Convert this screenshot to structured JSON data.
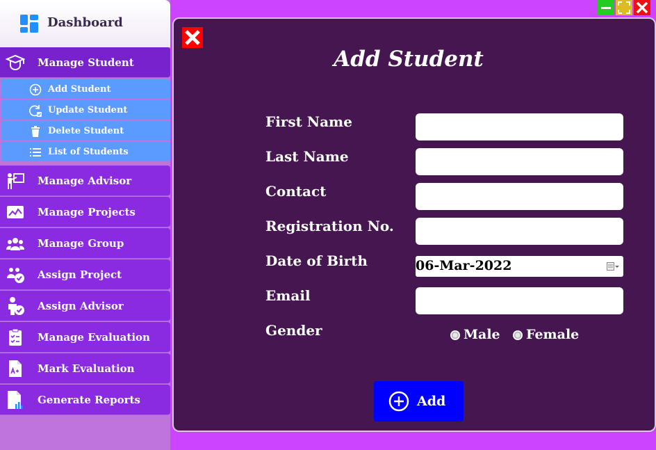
{
  "sidebar": {
    "dashboard_label": "Dashboard",
    "items": [
      {
        "label": "Manage Student",
        "icon": "graduate-icon"
      },
      {
        "label": "Manage Advisor",
        "icon": "teacher-board-icon"
      },
      {
        "label": "Manage Projects",
        "icon": "chart-image-icon"
      },
      {
        "label": "Manage Group",
        "icon": "group-icon"
      },
      {
        "label": "Assign Project",
        "icon": "people-check-icon"
      },
      {
        "label": "Assign Advisor",
        "icon": "person-check-icon"
      },
      {
        "label": "Manage Evaluation",
        "icon": "clipboard-check-icon"
      },
      {
        "label": "Mark Evaluation",
        "icon": "grade-document-icon"
      },
      {
        "label": "Generate Reports",
        "icon": "report-document-icon"
      }
    ],
    "sub_items": [
      {
        "label": "Add Student",
        "icon": "plus-circle-icon"
      },
      {
        "label": "Update Student",
        "icon": "refresh-check-icon"
      },
      {
        "label": "Delete Student",
        "icon": "trash-icon"
      },
      {
        "label": "List of Students",
        "icon": "list-icon"
      }
    ]
  },
  "form": {
    "title": "Add Student",
    "labels": {
      "first_name": "First Name",
      "last_name": "Last Name",
      "contact": "Contact",
      "registration": "Registration No.",
      "dob": "Date of Birth",
      "email": "Email",
      "gender": "Gender"
    },
    "values": {
      "first_name": "",
      "last_name": "",
      "contact": "",
      "registration": "",
      "dob": "06-Mar-2022",
      "email": ""
    },
    "gender_options": {
      "male": "Male",
      "female": "Female"
    },
    "add_label": "Add"
  },
  "colors": {
    "sidebar_item": "#8a2be2",
    "sub_item": "#5b9bff",
    "panel": "#451650",
    "add_button": "#0000ff",
    "background": "#cc44ff"
  }
}
